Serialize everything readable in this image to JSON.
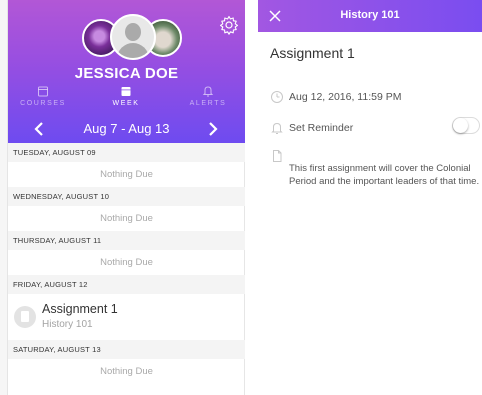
{
  "profile": {
    "name": "JESSICA DOE"
  },
  "tabs": [
    {
      "label": "COURSES",
      "active": false
    },
    {
      "label": "WEEK",
      "active": true
    },
    {
      "label": "ALERTS",
      "active": false
    }
  ],
  "week_nav": {
    "range": "Aug 7 - Aug 13",
    "prev": "‹",
    "next": "›"
  },
  "days": [
    {
      "header": "TUESDAY, AUGUST 09",
      "empty_text": "Nothing Due"
    },
    {
      "header": "WEDNESDAY, AUGUST 10",
      "empty_text": "Nothing Due"
    },
    {
      "header": "THURSDAY, AUGUST 11",
      "empty_text": "Nothing Due"
    },
    {
      "header": "FRIDAY, AUGUST 12",
      "assignment": {
        "title": "Assignment 1",
        "course": "History 101"
      }
    },
    {
      "header": "SATURDAY, AUGUST 13",
      "empty_text": "Nothing Due"
    }
  ],
  "detail": {
    "course": "History 101",
    "title": "Assignment 1",
    "due": "Aug 12, 2016, 11:59 PM",
    "reminder_label": "Set Reminder",
    "reminder_on": false,
    "description": "This first assignment will cover the Colonial Period and the important leaders of that time."
  },
  "colors": {
    "accent_start": "#b257d6",
    "accent_end": "#6e4bf0"
  },
  "icons": [
    "gear-icon",
    "calendar-icon",
    "bell-icon",
    "chevron-left-icon",
    "chevron-right-icon",
    "close-icon",
    "clock-icon",
    "document-icon"
  ]
}
